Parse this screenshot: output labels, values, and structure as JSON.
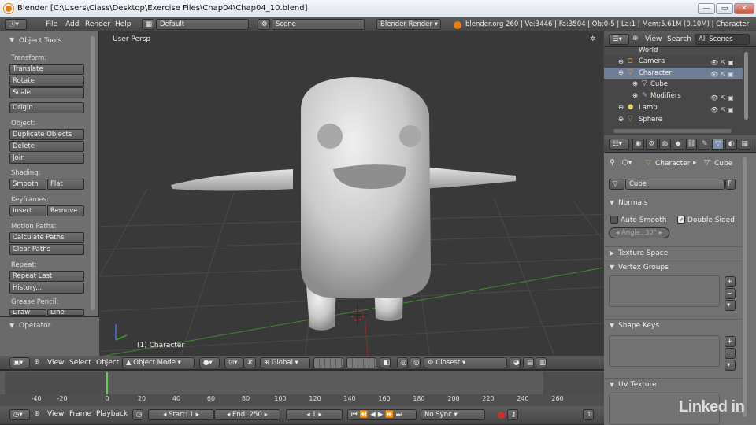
{
  "window": {
    "title": "Blender  [C:\\Users\\Class\\Desktop\\Exercise Files\\Chap04\\Chap04_10.blend]",
    "min": "—",
    "max": "▭",
    "close": "✕"
  },
  "infobar": {
    "menus": [
      "File",
      "Add",
      "Render",
      "Help"
    ],
    "screen_layout": "Default",
    "scene": "Scene",
    "render_engine": "Blender Render",
    "stats": "blender.org 260 | Ve:3446 | Fa:3504 | Ob:0-5 | La:1 | Mem:5.61M (0.10M) | Character"
  },
  "tool_shelf": {
    "title": "Object Tools",
    "sections": [
      {
        "label": "Transform:",
        "buttons": [
          "Translate",
          "Rotate",
          "Scale"
        ]
      },
      {
        "label": "",
        "buttons": [
          "Origin"
        ]
      },
      {
        "label": "Object:",
        "buttons": [
          "Duplicate Objects",
          "Delete",
          "Join"
        ]
      },
      {
        "label": "Shading:",
        "pair": [
          "Smooth",
          "Flat"
        ]
      },
      {
        "label": "Keyframes:",
        "pair": [
          "Insert",
          "Remove"
        ]
      },
      {
        "label": "Motion Paths:",
        "buttons": [
          "Calculate Paths",
          "Clear Paths"
        ]
      },
      {
        "label": "Repeat:",
        "buttons": [
          "Repeat Last",
          "History..."
        ]
      },
      {
        "label": "Grease Pencil:",
        "pair": [
          "Draw",
          "Line"
        ]
      }
    ],
    "operator": "Operator"
  },
  "viewport": {
    "view_label": "User Persp",
    "object_label": "(1) Character",
    "header": {
      "menus": [
        "View",
        "Select",
        "Object"
      ],
      "mode": "Object Mode",
      "orientation": "Global",
      "snap": "Closest"
    }
  },
  "outliner": {
    "menus": [
      "View",
      "Search"
    ],
    "scenes": "All Scenes",
    "items": [
      {
        "label": "World",
        "icon": "world-icon"
      },
      {
        "label": "Camera",
        "icon": "camera-icon"
      },
      {
        "label": "Character",
        "icon": "mesh-icon",
        "selected": true
      },
      {
        "label": "Cube",
        "icon": "mesh-data-icon"
      },
      {
        "label": "Modifiers",
        "icon": "wrench-icon"
      },
      {
        "label": "Lamp",
        "icon": "lamp-icon"
      },
      {
        "label": "Sphere",
        "icon": "mesh-icon"
      }
    ]
  },
  "properties": {
    "breadcrumb": [
      "Character",
      "Cube"
    ],
    "datablock": "Cube",
    "fake_user": "F",
    "normals": {
      "title": "Normals",
      "auto_smooth": "Auto Smooth",
      "double_sided": "Double Sided",
      "angle": "Angle: 30°"
    },
    "texture_space": "Texture Space",
    "vertex_groups": "Vertex Groups",
    "shape_keys": "Shape Keys",
    "uv_texture": "UV Texture"
  },
  "timeline": {
    "ticks": [
      "-40",
      "-20",
      "0",
      "20",
      "40",
      "60",
      "80",
      "100",
      "120",
      "140",
      "160",
      "180",
      "200",
      "220",
      "240",
      "260"
    ],
    "menus": [
      "View",
      "Frame",
      "Playback"
    ],
    "start": "Start: 1",
    "end": "End: 250",
    "current": "1",
    "sync": "No Sync"
  },
  "watermark": "Linked in",
  "colors": {
    "accent": "#5680c2",
    "selected_row": "#6e7e96",
    "panel": "#727272",
    "viewport": "#393939"
  }
}
